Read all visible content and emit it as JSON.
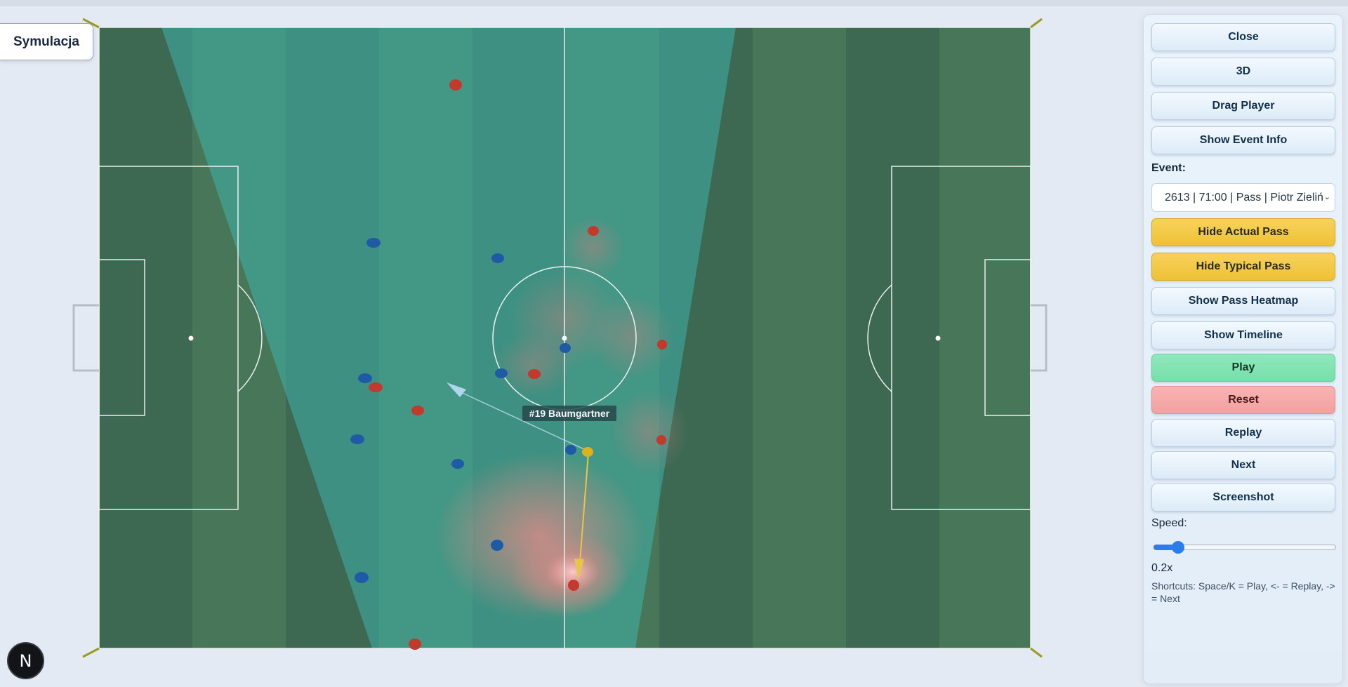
{
  "badge": {
    "title": "Symulacja"
  },
  "pitch": {
    "highlighted_player": "#19 Baumgartner"
  },
  "controls": {
    "close": "Close",
    "view_3d": "3D",
    "drag_player": "Drag Player",
    "show_event_info": "Show Event Info",
    "event_label": "Event:",
    "event_selected": "2613 | 71:00 | Pass | Piotr Zieliń",
    "hide_actual_pass": "Hide Actual Pass",
    "hide_typical_pass": "Hide Typical Pass",
    "show_pass_heatmap": "Show Pass Heatmap",
    "show_timeline": "Show Timeline",
    "play": "Play",
    "reset": "Reset",
    "replay": "Replay",
    "next": "Next",
    "screenshot": "Screenshot",
    "speed_label": "Speed:",
    "speed_value": "0.2x",
    "speed_level": 0.2,
    "shortcuts": "Shortcuts: Space/K = Play, <- = Replay, -> = Next"
  },
  "logo": {
    "letter": "N"
  },
  "colors": {
    "team_home": "#c2392d",
    "team_away": "#1f5aa6",
    "passer": "#d9b21c",
    "typical_pass_arrow": "#aed7ee",
    "actual_pass_arrow": "#e8c54a",
    "button_yellow": "#f2c744",
    "button_green": "#7fe2b0",
    "button_red": "#f6aaaa"
  }
}
